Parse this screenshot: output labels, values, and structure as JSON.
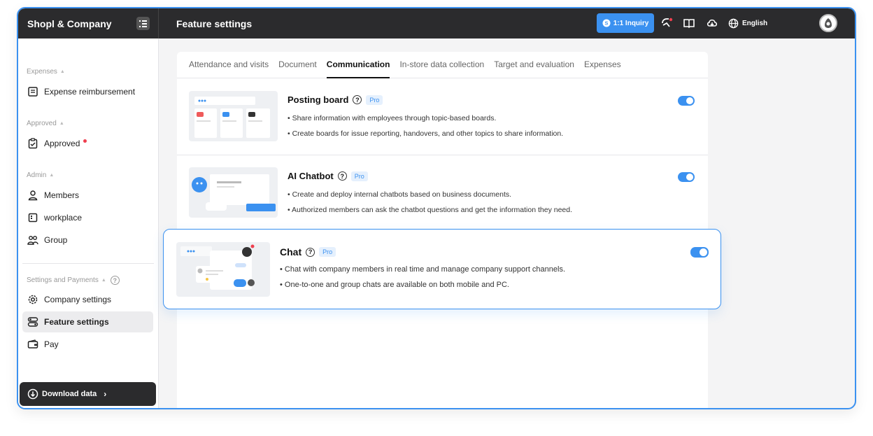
{
  "header": {
    "brand": "Shopl & Company",
    "page_title": "Feature settings",
    "inquiry_label": "1:1 Inquiry",
    "language": "English"
  },
  "sidebar": {
    "sections": [
      {
        "label": "Expenses",
        "items": [
          {
            "label": "Expense reimbursement",
            "icon": "receipt-icon"
          }
        ]
      },
      {
        "label": "Approved",
        "items": [
          {
            "label": "Approved",
            "icon": "clipboard-check-icon",
            "badge": "red-dot"
          }
        ]
      },
      {
        "label": "Admin",
        "items": [
          {
            "label": "Members",
            "icon": "user-icon"
          },
          {
            "label": "workplace",
            "icon": "building-icon"
          },
          {
            "label": "Group",
            "icon": "group-icon"
          }
        ]
      },
      {
        "label": "Settings and Payments",
        "items": [
          {
            "label": "Company settings",
            "icon": "gear-icon"
          },
          {
            "label": "Feature settings",
            "icon": "toggles-icon",
            "active": true
          },
          {
            "label": "Pay",
            "icon": "wallet-icon"
          }
        ]
      }
    ],
    "download_label": "Download data"
  },
  "tabs": [
    {
      "label": "Attendance and visits"
    },
    {
      "label": "Document"
    },
    {
      "label": "Communication",
      "active": true
    },
    {
      "label": "In-store data collection"
    },
    {
      "label": "Target and evaluation"
    },
    {
      "label": "Expenses"
    }
  ],
  "features": [
    {
      "title": "Posting board",
      "badge": "Pro",
      "enabled": true,
      "bullets": [
        "Share information with employees through topic-based boards.",
        "Create boards for issue reporting, handovers, and other topics to share information."
      ]
    },
    {
      "title": "AI Chatbot",
      "badge": "Pro",
      "enabled": true,
      "bullets": [
        "Create and deploy internal chatbots based on business documents.",
        "Authorized members can ask the chatbot questions and get the information they need."
      ]
    },
    {
      "title": "Chat",
      "badge": "Pro",
      "enabled": true,
      "bullets": [
        "Chat with company members in real time and manage company support channels.",
        "One-to-one and group chats are available on both mobile and PC."
      ]
    }
  ],
  "colors": {
    "accent": "#3b91f0",
    "topbar": "#2b2b2d",
    "badge_red": "#ef3f4f"
  }
}
